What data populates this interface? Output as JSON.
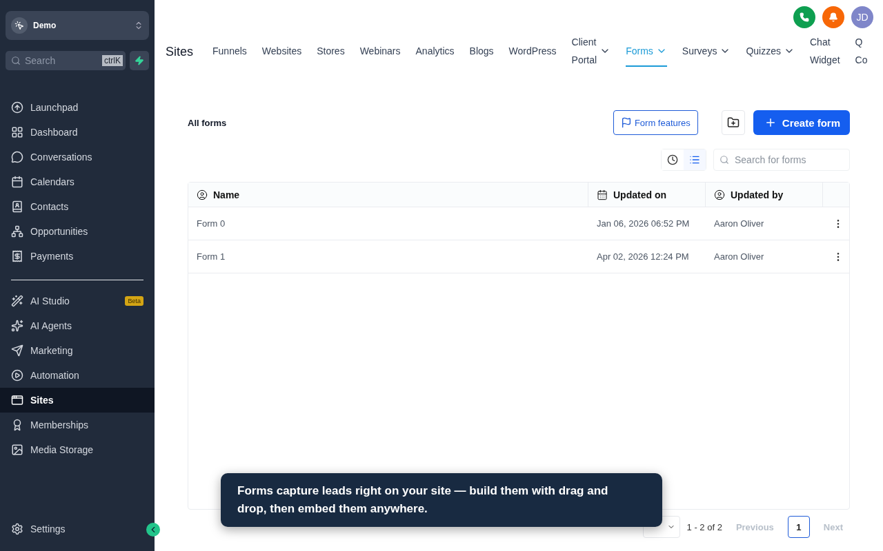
{
  "sidebar": {
    "workspace": "Demo",
    "search": {
      "placeholder": "Search",
      "shortcut": "ctrlK"
    },
    "sections": [
      [
        {
          "label": "Launchpad",
          "selected": false
        },
        {
          "label": "Dashboard",
          "selected": false
        },
        {
          "label": "Conversations",
          "selected": false
        },
        {
          "label": "Calendars",
          "selected": false
        },
        {
          "label": "Contacts",
          "selected": false
        },
        {
          "label": "Opportunities",
          "selected": false
        },
        {
          "label": "Payments",
          "selected": false
        }
      ],
      [
        {
          "label": "AI Studio",
          "selected": false,
          "badge": "Beta"
        },
        {
          "label": "AI Agents",
          "selected": false
        },
        {
          "label": "Marketing",
          "selected": false
        },
        {
          "label": "Automation",
          "selected": false
        },
        {
          "label": "Sites",
          "selected": true
        },
        {
          "label": "Memberships",
          "selected": false
        },
        {
          "label": "Media Storage",
          "selected": false
        }
      ]
    ],
    "settings": "Settings"
  },
  "header": {
    "avatar": "JD"
  },
  "nav": {
    "title": "Sites",
    "tabs": [
      {
        "lines": [
          "Funnels"
        ],
        "dropdown": false,
        "selected": false
      },
      {
        "lines": [
          "Websites"
        ],
        "dropdown": false,
        "selected": false
      },
      {
        "lines": [
          "Stores"
        ],
        "dropdown": false,
        "selected": false
      },
      {
        "lines": [
          "Webinars"
        ],
        "dropdown": false,
        "selected": false
      },
      {
        "lines": [
          "Analytics"
        ],
        "dropdown": false,
        "selected": false
      },
      {
        "lines": [
          "Blogs"
        ],
        "dropdown": false,
        "selected": false
      },
      {
        "lines": [
          "WordPress"
        ],
        "dropdown": false,
        "selected": false
      },
      {
        "lines": [
          "Client",
          "Portal"
        ],
        "dropdown": true,
        "selected": false
      },
      {
        "lines": [
          "Forms"
        ],
        "dropdown": true,
        "selected": true
      },
      {
        "lines": [
          "Surveys"
        ],
        "dropdown": true,
        "selected": false
      },
      {
        "lines": [
          "Quizzes"
        ],
        "dropdown": true,
        "selected": false
      },
      {
        "lines": [
          "Chat",
          "Widget"
        ],
        "dropdown": false,
        "selected": false
      },
      {
        "lines": [
          "Q",
          "Co"
        ],
        "dropdown": false,
        "selected": false
      }
    ]
  },
  "forms": {
    "title": "All forms",
    "features_button": "Form features",
    "create_button": "Create form",
    "view_toggle": [
      {
        "selected": false
      },
      {
        "selected": true
      }
    ],
    "search": {
      "placeholder": "Search for forms"
    },
    "table": {
      "columns": [
        "Name",
        "Updated on",
        "Updated by"
      ],
      "rows": [
        {
          "name": "Form 0",
          "updated_on": "Jan 06, 2026 06:52 PM",
          "updated_by": "Aaron Oliver"
        },
        {
          "name": "Form 1",
          "updated_on": "Apr 02, 2026 12:24 PM",
          "updated_by": "Aaron Oliver"
        }
      ]
    },
    "pagination": {
      "range": "1 - 2 of 2",
      "previous": "Previous",
      "pages": [
        {
          "label": "1",
          "selected": true
        }
      ],
      "next": "Next"
    }
  },
  "tooltip": "Forms capture leads right on your site — build them with drag and drop, then embed them anywhere."
}
